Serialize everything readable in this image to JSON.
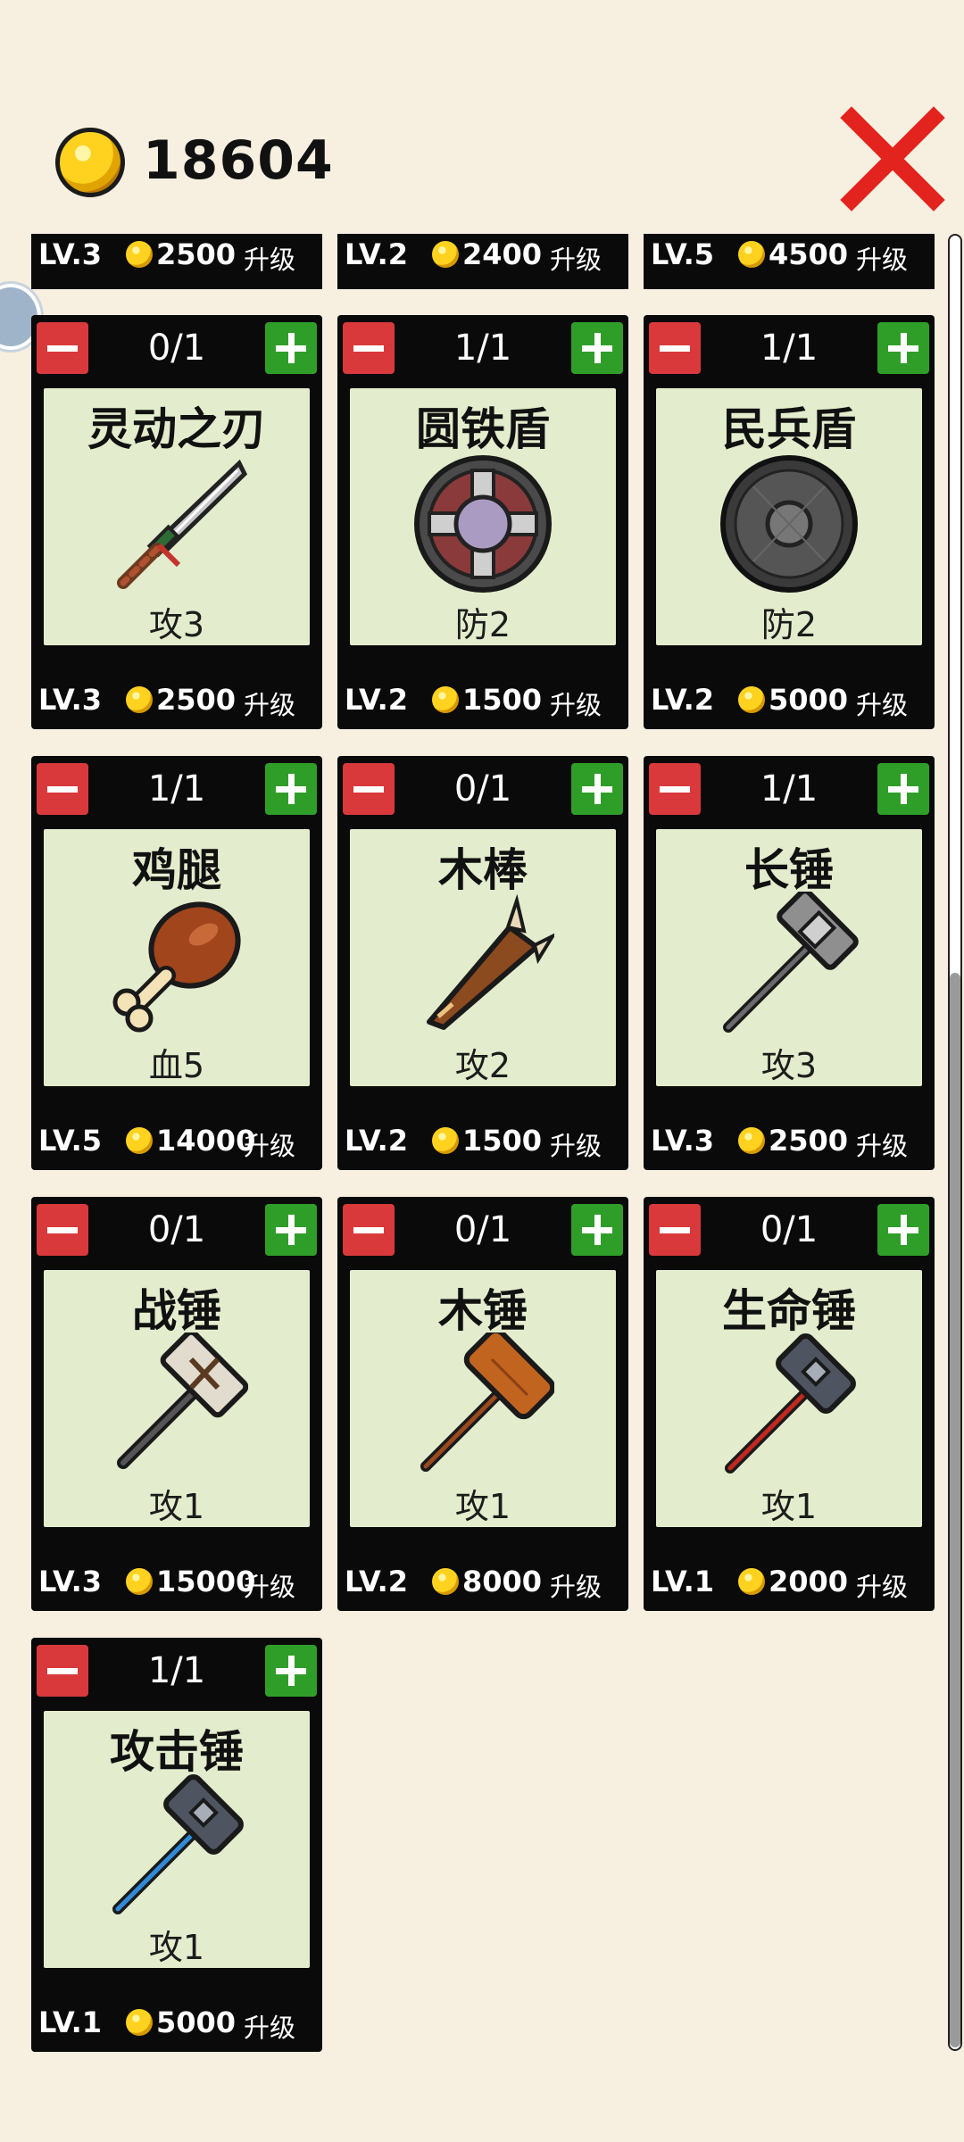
{
  "header": {
    "gold_icon": "gold-coin-icon",
    "gold_amount": "18604",
    "close_icon": "close-x-icon"
  },
  "colors": {
    "background": "#f7efe0",
    "card": "#0a0a0a",
    "panel": "#e3eccc",
    "minus": "#d9393b",
    "plus": "#2f9e29",
    "close": "#e3231d"
  },
  "top_strip": [
    {
      "level": "LV.3",
      "cost": "2500",
      "upgrade": "升级"
    },
    {
      "level": "LV.2",
      "cost": "2400",
      "upgrade": "升级"
    },
    {
      "level": "LV.5",
      "cost": "4500",
      "upgrade": "升级"
    }
  ],
  "items": [
    {
      "count": "0/1",
      "name": "灵动之刃",
      "icon": "sword-icon",
      "stat": "攻3",
      "level": "LV.3",
      "cost": "2500",
      "upgrade": "升级"
    },
    {
      "count": "1/1",
      "name": "圆铁盾",
      "icon": "round-iron-shield-icon",
      "stat": "防2",
      "level": "LV.2",
      "cost": "1500",
      "upgrade": "升级"
    },
    {
      "count": "1/1",
      "name": "民兵盾",
      "icon": "militia-shield-icon",
      "stat": "防2",
      "level": "LV.2",
      "cost": "5000",
      "upgrade": "升级"
    },
    {
      "count": "1/1",
      "name": "鸡腿",
      "icon": "chicken-leg-icon",
      "stat": "血5",
      "level": "LV.5",
      "cost": "14000",
      "upgrade": "升级"
    },
    {
      "count": "0/1",
      "name": "木棒",
      "icon": "wooden-club-icon",
      "stat": "攻2",
      "level": "LV.2",
      "cost": "1500",
      "upgrade": "升级"
    },
    {
      "count": "1/1",
      "name": "长锤",
      "icon": "long-hammer-icon",
      "stat": "攻3",
      "level": "LV.3",
      "cost": "2500",
      "upgrade": "升级"
    },
    {
      "count": "0/1",
      "name": "战锤",
      "icon": "war-hammer-icon",
      "stat": "攻1",
      "level": "LV.3",
      "cost": "15000",
      "upgrade": "升级"
    },
    {
      "count": "0/1",
      "name": "木锤",
      "icon": "wooden-mallet-icon",
      "stat": "攻1",
      "level": "LV.2",
      "cost": "8000",
      "upgrade": "升级"
    },
    {
      "count": "0/1",
      "name": "生命锤",
      "icon": "life-hammer-icon",
      "stat": "攻1",
      "level": "LV.1",
      "cost": "2000",
      "upgrade": "升级"
    },
    {
      "count": "1/1",
      "name": "攻击锤",
      "icon": "attack-hammer-icon",
      "stat": "攻1",
      "level": "LV.1",
      "cost": "5000",
      "upgrade": "升级"
    }
  ]
}
